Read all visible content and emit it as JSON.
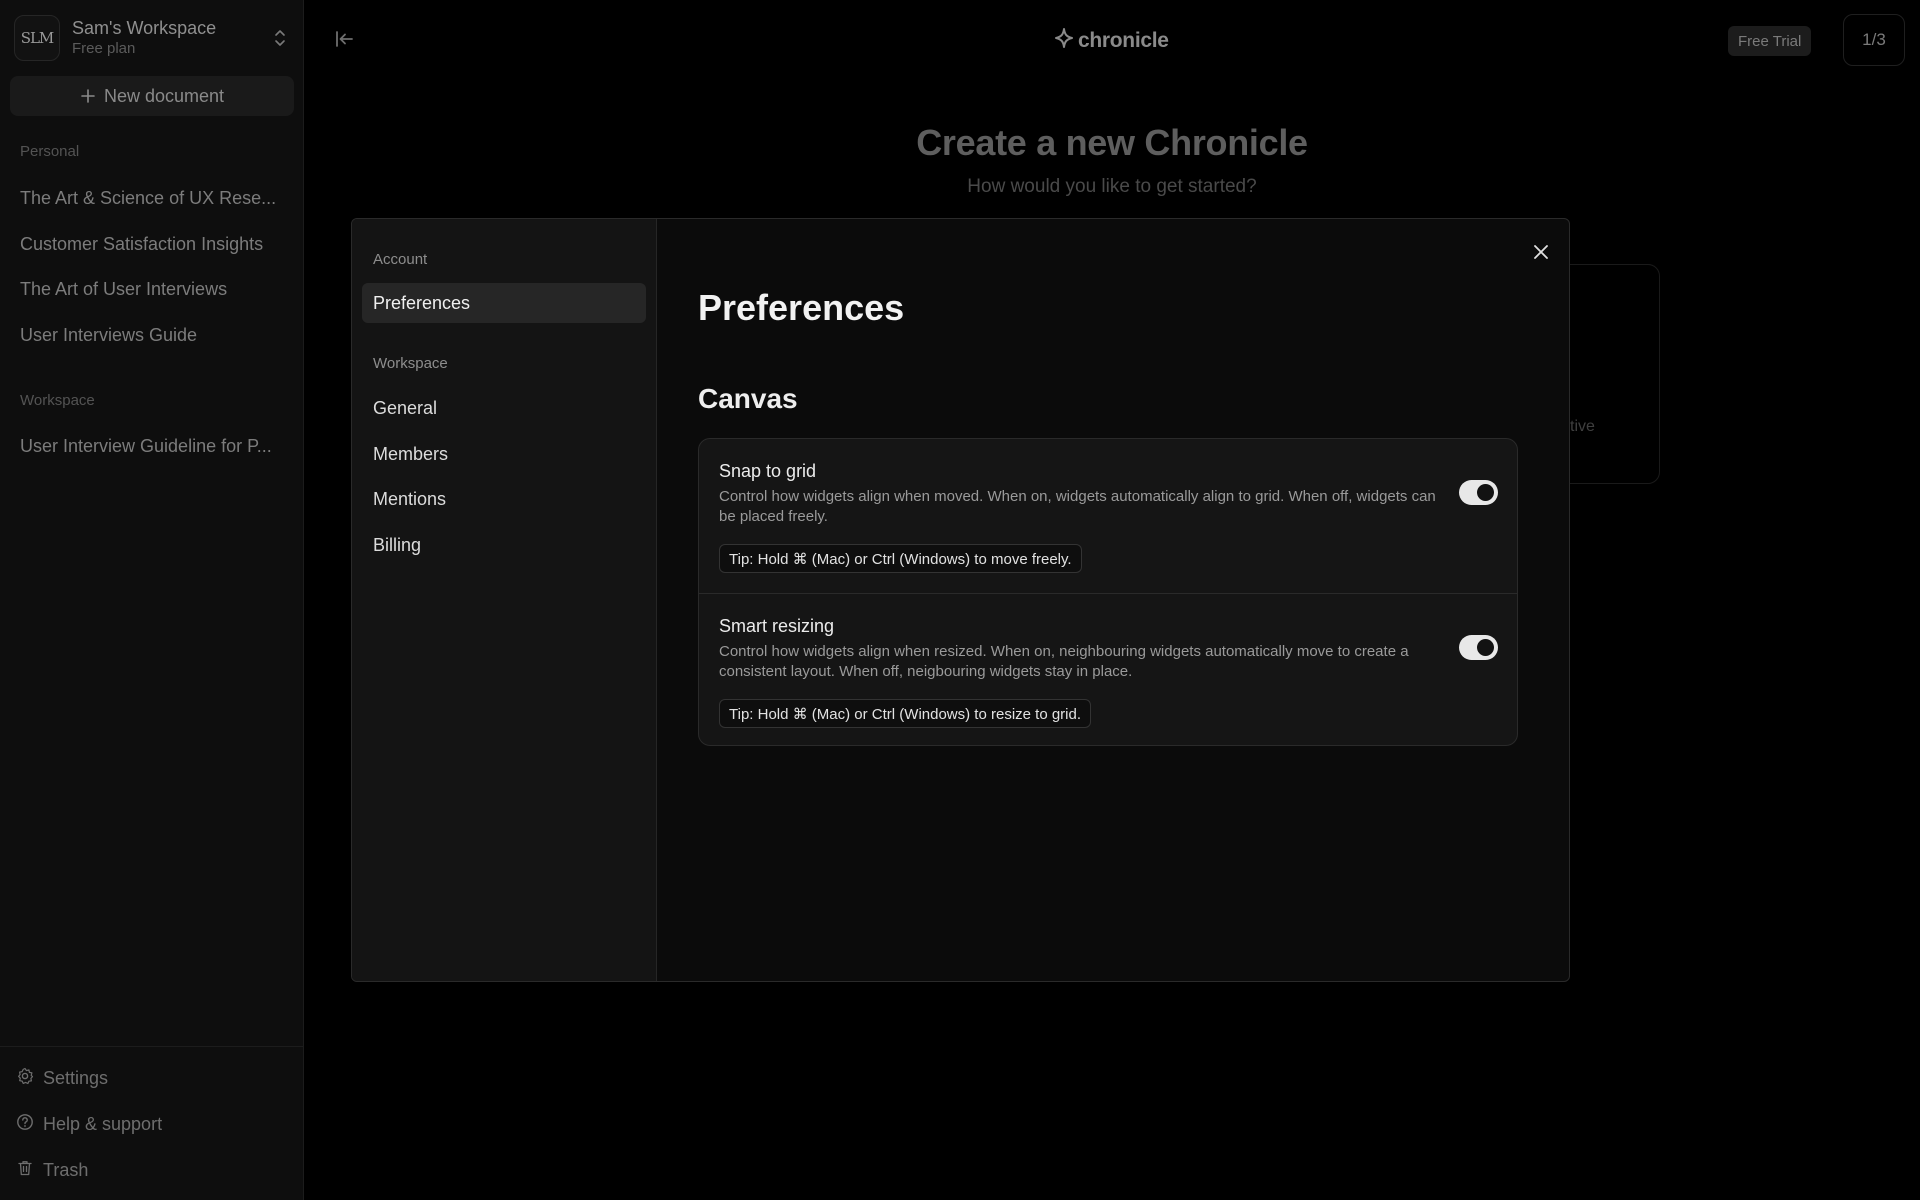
{
  "sidebar": {
    "workspace": {
      "logo_text": "SLM",
      "name": "Sam's Workspace",
      "plan": "Free plan"
    },
    "new_document_label": "New document",
    "personal_section": "Personal",
    "personal_items": [
      "The Art & Science of UX Rese...",
      "Customer Satisfaction Insights",
      "The Art of User Interviews",
      "User Interviews Guide"
    ],
    "workspace_section": "Workspace",
    "workspace_items": [
      "User Interview Guideline for P..."
    ],
    "bottom": {
      "settings": "Settings",
      "help": "Help & support",
      "trash": "Trash"
    }
  },
  "topbar": {
    "brand": "chronicle",
    "free_trial": "Free Trial",
    "counter": "1/3"
  },
  "background": {
    "title": "Create a new Chronicle",
    "subtitle": "How would you like to get started?",
    "card_fragment": "ctive"
  },
  "modal": {
    "nav": {
      "account_section": "Account",
      "preferences": "Preferences",
      "workspace_section": "Workspace",
      "general": "General",
      "members": "Members",
      "mentions": "Mentions",
      "billing": "Billing"
    },
    "title": "Preferences",
    "section": "Canvas",
    "settings": [
      {
        "label": "Snap to grid",
        "description": "Control how widgets align when moved. When on, widgets automatically align to grid. When off, widgets can be placed freely.",
        "tip": "Tip: Hold ⌘ (Mac) or Ctrl (Windows) to move freely.",
        "enabled": true
      },
      {
        "label": "Smart resizing",
        "description": "Control how widgets align when resized. When on, neighbouring widgets automatically move to create a consistent layout. When off, neigbouring widgets stay in place.",
        "tip": "Tip: Hold ⌘ (Mac) or Ctrl (Windows) to resize to grid.",
        "enabled": true
      }
    ]
  },
  "colors": {
    "background": "#000000",
    "sidebar": "#0e0e0e",
    "modal": "#0b0b0b",
    "modal_nav": "#141414",
    "toggle_on": "#e8e8e8"
  },
  "icons": {
    "workspace_switch": "chevron-up-down-icon",
    "new_document": "plus-icon",
    "collapse": "collapse-sidebar-icon",
    "brand": "sparkle-icon",
    "close": "close-icon",
    "settings": "gear-icon",
    "help": "question-circle-icon",
    "trash": "trash-icon"
  }
}
